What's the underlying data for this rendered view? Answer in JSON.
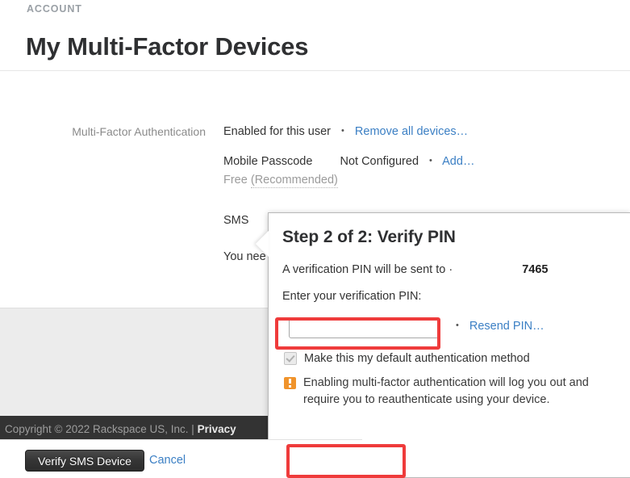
{
  "header": {
    "eyebrow": "ACCOUNT",
    "title": "My Multi-Factor Devices"
  },
  "settings": {
    "mfa_label": "Multi-Factor Authentication",
    "mfa_status": "Enabled for this user",
    "remove_all_link": "Remove all devices…",
    "mobile_passcode_name": "Mobile Passcode",
    "mobile_passcode_status": "Not Configured",
    "mobile_passcode_add_link": "Add…",
    "mobile_passcode_note_free": "Free",
    "mobile_passcode_note_recommended": "(Recommended)",
    "sms_name": "SMS",
    "truncated_note": "You nee",
    "separator": "•"
  },
  "modal": {
    "title": "Step 2 of 2: Verify PIN",
    "sent_to_prefix": "A verification PIN will be sent to ·",
    "sent_to_number": "7465",
    "pin_label": "Enter your verification PIN:",
    "pin_value": "",
    "pin_placeholder": "",
    "separator": "•",
    "resend_link": "Resend PIN…",
    "default_method_label": "Make this my default authentication method",
    "default_method_checked": true,
    "warning_text": "Enabling multi-factor authentication will log you out and require you to reauthenticate using your device.",
    "verify_button": "Verify SMS Device",
    "cancel_link": "Cancel"
  },
  "footer": {
    "copyright": "Copyright © 2022 Rackspace US, Inc. | ",
    "privacy_link": "Privacy"
  },
  "colors": {
    "link": "#3b7fc4",
    "warning": "#f0932b",
    "annotation": "#ef3b3b",
    "footer_bar": "#333333",
    "page_grey": "#ececec"
  }
}
